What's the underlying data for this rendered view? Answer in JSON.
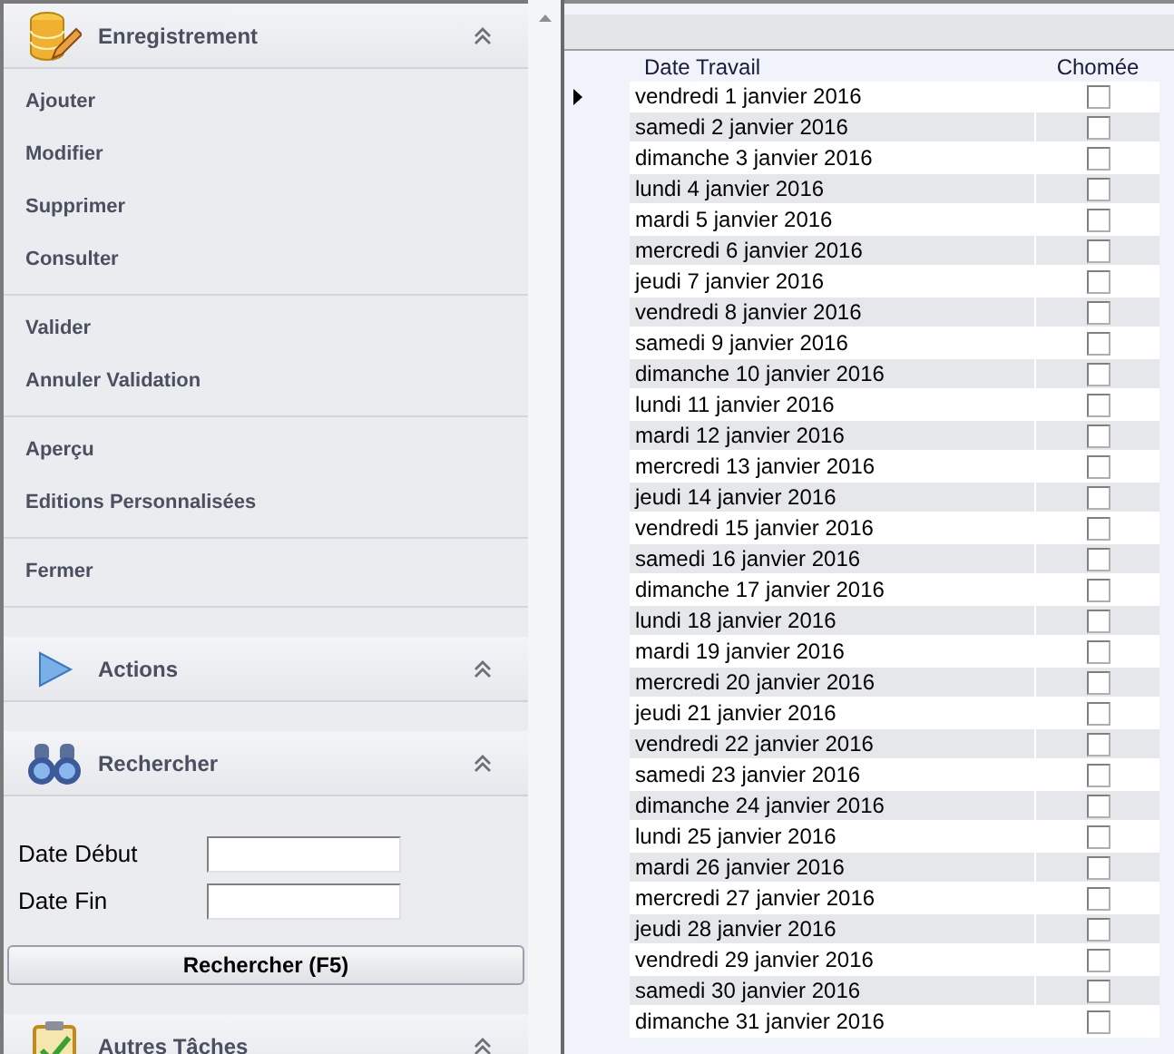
{
  "sidebar": {
    "sections": [
      {
        "title": "Enregistrement",
        "kind": "database",
        "groups": [
          {
            "items": [
              "Ajouter",
              "Modifier",
              "Supprimer",
              "Consulter"
            ]
          },
          {
            "items": [
              "Valider",
              "Annuler Validation"
            ]
          },
          {
            "items": [
              "Aperçu",
              "Editions Personnalisées"
            ]
          },
          {
            "items": [
              "Fermer"
            ]
          }
        ]
      },
      {
        "title": "Actions",
        "kind": "play"
      },
      {
        "title": "Rechercher",
        "kind": "binoculars",
        "fields": [
          {
            "label": "Date Début"
          },
          {
            "label": "Date Fin"
          }
        ],
        "button": "Rechercher (F5)"
      },
      {
        "title": "Autres Tâches",
        "kind": "clipboard"
      }
    ]
  },
  "table": {
    "columns": [
      "Date Travail",
      "Chomée"
    ],
    "rows": [
      {
        "date": "vendredi 1 janvier 2016",
        "checked": false,
        "selected": true
      },
      {
        "date": "samedi 2 janvier 2016",
        "checked": false,
        "selected": false
      },
      {
        "date": "dimanche 3 janvier 2016",
        "checked": false,
        "selected": false
      },
      {
        "date": "lundi 4 janvier 2016",
        "checked": false,
        "selected": false
      },
      {
        "date": "mardi 5 janvier 2016",
        "checked": false,
        "selected": false
      },
      {
        "date": "mercredi 6 janvier 2016",
        "checked": false,
        "selected": false
      },
      {
        "date": "jeudi 7 janvier 2016",
        "checked": false,
        "selected": false
      },
      {
        "date": "vendredi 8 janvier 2016",
        "checked": false,
        "selected": false
      },
      {
        "date": "samedi 9 janvier 2016",
        "checked": false,
        "selected": false
      },
      {
        "date": "dimanche 10 janvier 2016",
        "checked": false,
        "selected": false
      },
      {
        "date": "lundi 11 janvier 2016",
        "checked": false,
        "selected": false
      },
      {
        "date": "mardi 12 janvier 2016",
        "checked": false,
        "selected": false
      },
      {
        "date": "mercredi 13 janvier 2016",
        "checked": false,
        "selected": false
      },
      {
        "date": "jeudi 14 janvier 2016",
        "checked": false,
        "selected": false
      },
      {
        "date": "vendredi 15 janvier 2016",
        "checked": false,
        "selected": false
      },
      {
        "date": "samedi 16 janvier 2016",
        "checked": false,
        "selected": false
      },
      {
        "date": "dimanche 17 janvier 2016",
        "checked": false,
        "selected": false
      },
      {
        "date": "lundi 18 janvier 2016",
        "checked": false,
        "selected": false
      },
      {
        "date": "mardi 19 janvier 2016",
        "checked": false,
        "selected": false
      },
      {
        "date": "mercredi 20 janvier 2016",
        "checked": false,
        "selected": false
      },
      {
        "date": "jeudi 21 janvier 2016",
        "checked": false,
        "selected": false
      },
      {
        "date": "vendredi 22 janvier 2016",
        "checked": false,
        "selected": false
      },
      {
        "date": "samedi 23 janvier 2016",
        "checked": false,
        "selected": false
      },
      {
        "date": "dimanche 24 janvier 2016",
        "checked": false,
        "selected": false
      },
      {
        "date": "lundi 25 janvier 2016",
        "checked": false,
        "selected": false
      },
      {
        "date": "mardi 26 janvier 2016",
        "checked": false,
        "selected": false
      },
      {
        "date": "mercredi 27 janvier 2016",
        "checked": false,
        "selected": false
      },
      {
        "date": "jeudi 28 janvier 2016",
        "checked": false,
        "selected": false
      },
      {
        "date": "vendredi 29 janvier 2016",
        "checked": false,
        "selected": false
      },
      {
        "date": "samedi 30 janvier 2016",
        "checked": false,
        "selected": false
      },
      {
        "date": "dimanche 31 janvier 2016",
        "checked": false,
        "selected": false
      }
    ]
  }
}
